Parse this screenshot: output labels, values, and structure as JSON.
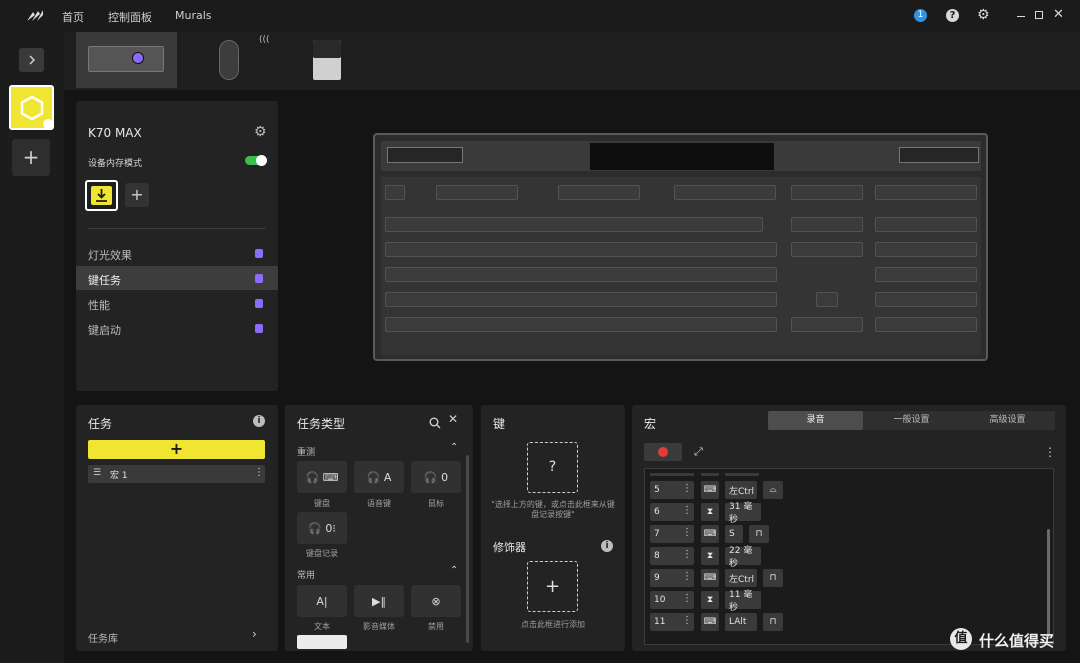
{
  "titlebar": {
    "nav": [
      "首页",
      "控制面板",
      "Murals"
    ],
    "notification_count": "1"
  },
  "device_panel": {
    "device_name": "K70 MAX",
    "memory_mode_label": "设备内存模式",
    "menu": [
      "灯光效果",
      "键任务",
      "性能",
      "键启动"
    ]
  },
  "tasks": {
    "title": "任务",
    "add_label": "+",
    "macro_item": "宏 1",
    "library_label": "任务库"
  },
  "task_types": {
    "title": "任务类型",
    "section_remap": "重测",
    "tiles": [
      "键盘",
      "语音键",
      "鼠标",
      "键盘记录"
    ],
    "section_common": "常用",
    "common_tiles": [
      "文本",
      "影音媒体",
      "禁用"
    ]
  },
  "key_panel": {
    "title": "键",
    "key_placeholder": "?",
    "key_hint": "\"选择上方的键，或点击此框来从键盘记录按键\"",
    "modifier_title": "修饰器",
    "modifier_hint": "点击此框进行添加"
  },
  "macro": {
    "title": "宏",
    "tabs": [
      "录音",
      "一般设置",
      "高级设置"
    ],
    "rows": [
      {
        "idx": "5",
        "type": "keyboard",
        "value": "左Ctrl",
        "action": "down"
      },
      {
        "idx": "6",
        "type": "delay",
        "value": "31 毫秒",
        "action": ""
      },
      {
        "idx": "7",
        "type": "keyboard",
        "value": "S",
        "action": "up"
      },
      {
        "idx": "8",
        "type": "delay",
        "value": "22 毫秒",
        "action": ""
      },
      {
        "idx": "9",
        "type": "keyboard",
        "value": "左Ctrl",
        "action": "up"
      },
      {
        "idx": "10",
        "type": "delay",
        "value": "11 毫秒",
        "action": ""
      },
      {
        "idx": "11",
        "type": "keyboard",
        "value": "LAlt",
        "action": "up"
      }
    ]
  },
  "watermark": "什么值得买",
  "colors": {
    "accent_yellow": "#f0e531",
    "accent_blue": "#2e95e6",
    "record_red": "#e23b3b",
    "lock_purple": "#8c6cff",
    "toggle_green": "#3dbd4b"
  }
}
